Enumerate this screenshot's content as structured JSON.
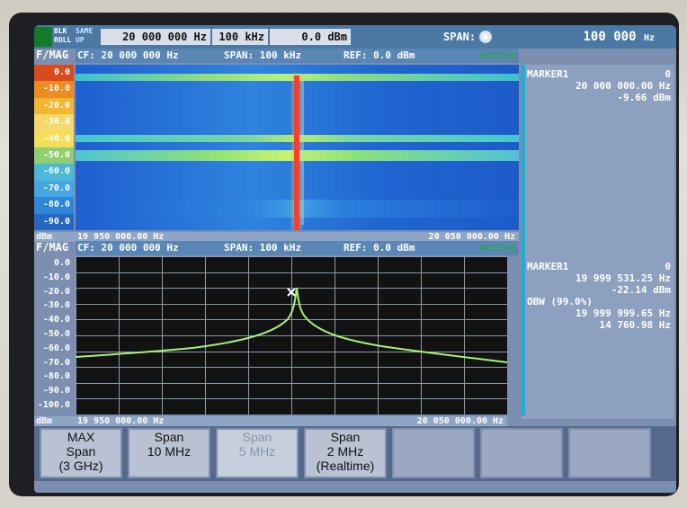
{
  "top_bar": {
    "status_1": "BLK",
    "status_2": "ROLL",
    "status_3": "SAME",
    "status_4": "UP",
    "cf": "20 000 000 Hz",
    "rbw": "100 kHz",
    "ref": "0.0 dBm",
    "span_label": "SPAN:",
    "span_value": "100 000",
    "span_unit": "Hz"
  },
  "waterfall": {
    "title": "F/MAG",
    "cf_label": "CF: 20 000 000 Hz",
    "span_label": "SPAN: 100 kHz",
    "ref_label": "REF: 0.0 dBm",
    "active": "Active",
    "unit": "dBm",
    "left_freq": "19 950 000.00 Hz",
    "right_freq": "20 050 000.00 Hz",
    "scale": [
      "0.0",
      "-10.0",
      "-20.0",
      "-30.0",
      "-40.0",
      "-50.0",
      "-60.0",
      "-70.0",
      "-80.0",
      "-90.0"
    ],
    "scale_colors": [
      "#d84b1d",
      "#f08b22",
      "#f5b632",
      "#f7d86a",
      "#f6dd5a",
      "#8fcf6f",
      "#4db9d8",
      "#44a6e2",
      "#2d86d7",
      "#2467c3"
    ]
  },
  "marker_panel_1": {
    "title": "MARKER1",
    "index": "0",
    "freq": "20 000 000.00 Hz",
    "level": "-9.66 dBm"
  },
  "spectrum": {
    "title": "F/MAG",
    "cf_label": "CF: 20 000 000 Hz",
    "span_label": "SPAN: 100 kHz",
    "ref_label": "REF: 0.0 dBm",
    "active": "Active",
    "unit": "dBm",
    "left_freq": "19 950 000.00 Hz",
    "right_freq": "20 050 000.00 Hz",
    "scale": [
      "0.0",
      "-10.0",
      "-20.0",
      "-30.0",
      "-40.0",
      "-50.0",
      "-60.0",
      "-70.0",
      "-80.0",
      "-90.0",
      "-100.0"
    ]
  },
  "marker_panel_2": {
    "title": "MARKER1",
    "index": "0",
    "freq": "19 999 531.25 Hz",
    "level": "-22.14 dBm",
    "obw_label": "OBW (99.0%)",
    "obw_freq_1": "19 999 999.65 Hz",
    "obw_freq_2": "14 760.98 Hz"
  },
  "softkeys": [
    {
      "l1": "MAX",
      "l2": "Span",
      "l3": "(3 GHz)"
    },
    {
      "l1": "Span",
      "l2": "10 MHz",
      "l3": ""
    },
    {
      "l1": "Span",
      "l2": "5 MHz",
      "l3": ""
    },
    {
      "l1": "Span",
      "l2": "2 MHz",
      "l3": "(Realtime)"
    }
  ]
}
